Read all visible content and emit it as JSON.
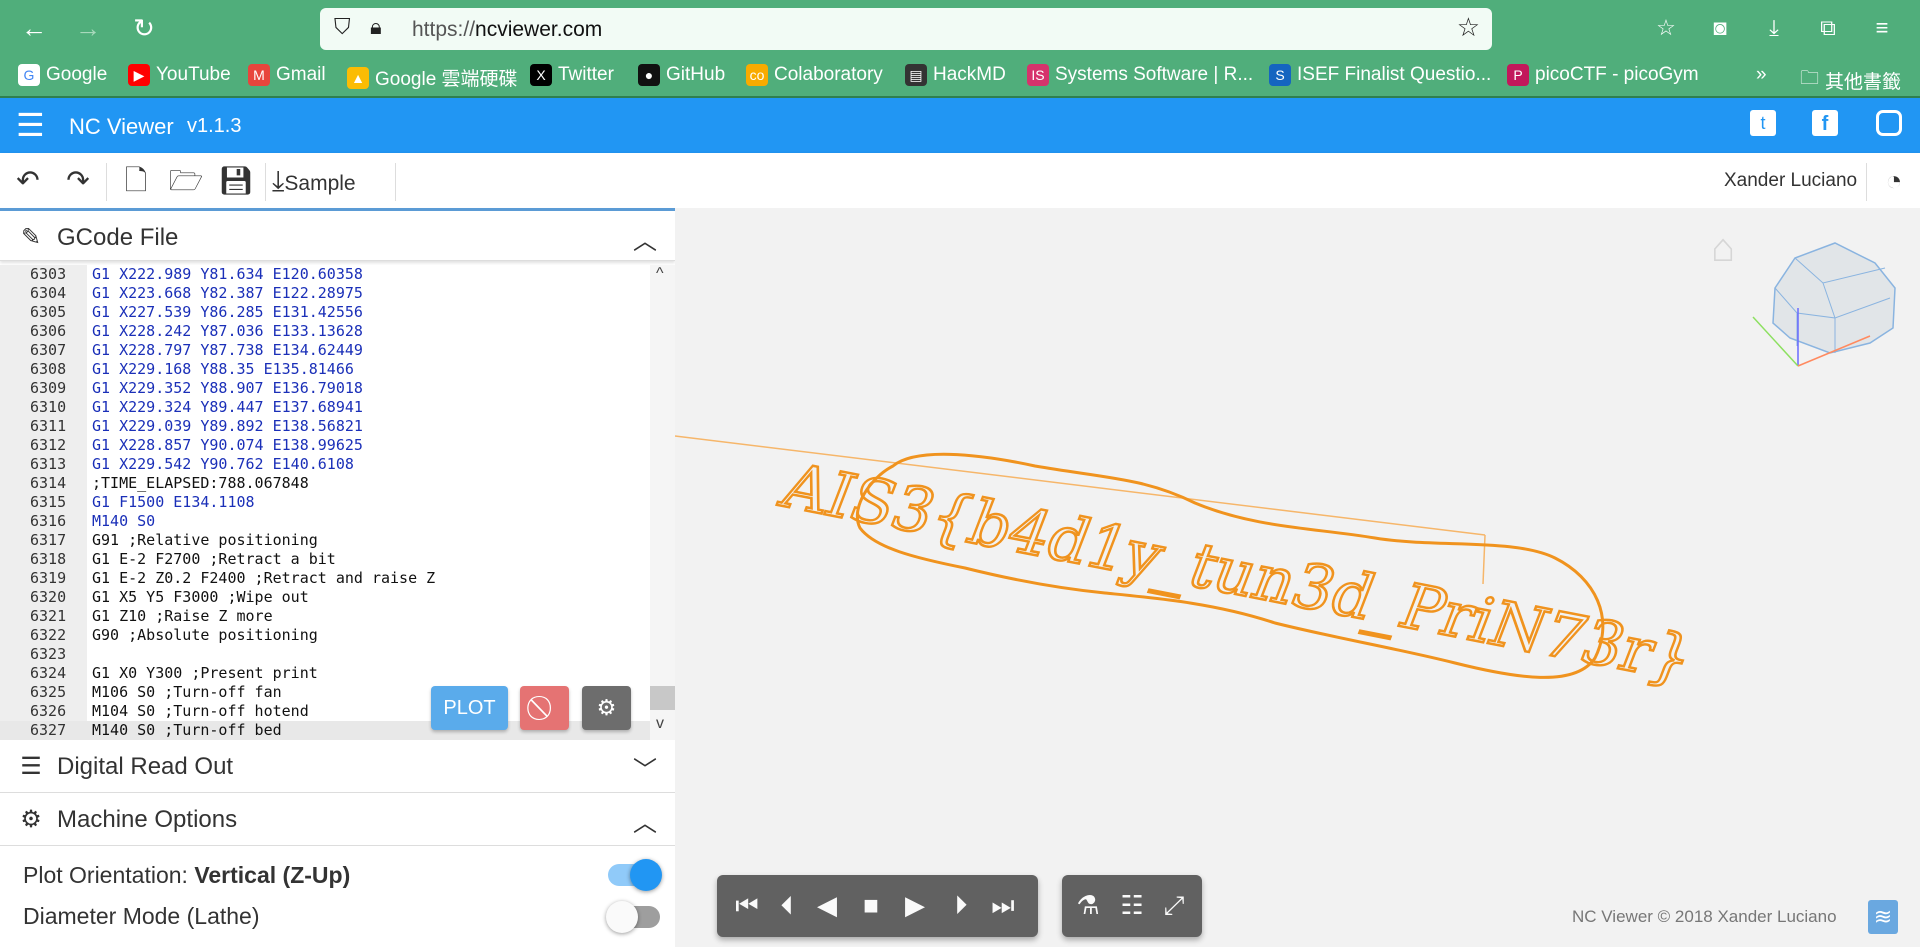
{
  "browser": {
    "url_prefix": "https://",
    "url_host": "ncviewer.com",
    "bookmarks": [
      {
        "label": "Google",
        "color": "#ffffff",
        "glyph": "G"
      },
      {
        "label": "YouTube",
        "color": "#ff0000",
        "glyph": "▶"
      },
      {
        "label": "Gmail",
        "color": "#e8453c",
        "glyph": "M"
      },
      {
        "label": "Google 雲端硬碟",
        "color": "#fbbc04",
        "glyph": "▲"
      },
      {
        "label": "Twitter",
        "color": "#000000",
        "glyph": "X"
      },
      {
        "label": "GitHub",
        "color": "#111111",
        "glyph": "●"
      },
      {
        "label": "Colaboratory",
        "color": "#f9ab00",
        "glyph": "co"
      },
      {
        "label": "HackMD",
        "color": "#333333",
        "glyph": "▤"
      },
      {
        "label": "Systems Software | R...",
        "color": "#d6336c",
        "glyph": "IS"
      },
      {
        "label": "ISEF Finalist Questio...",
        "color": "#1565c0",
        "glyph": "S"
      },
      {
        "label": "picoCTF - picoGym",
        "color": "#c2185b",
        "glyph": "P"
      }
    ],
    "other_bookmarks": "其他書籤"
  },
  "app": {
    "title": "NC Viewer",
    "version": "v1.1.3",
    "user": "Xander Luciano",
    "sample_label": "Sample"
  },
  "gcode_panel": {
    "title": "GCode File",
    "lines": [
      {
        "n": "6303",
        "t": "G1 X222.989 Y81.634 E120.60358"
      },
      {
        "n": "6304",
        "t": "G1 X223.668 Y82.387 E122.28975"
      },
      {
        "n": "6305",
        "t": "G1 X227.539 Y86.285 E131.42556"
      },
      {
        "n": "6306",
        "t": "G1 X228.242 Y87.036 E133.13628"
      },
      {
        "n": "6307",
        "t": "G1 X228.797 Y87.738 E134.62449"
      },
      {
        "n": "6308",
        "t": "G1 X229.168 Y88.35 E135.81466"
      },
      {
        "n": "6309",
        "t": "G1 X229.352 Y88.907 E136.79018"
      },
      {
        "n": "6310",
        "t": "G1 X229.324 Y89.447 E137.68941"
      },
      {
        "n": "6311",
        "t": "G1 X229.039 Y89.892 E138.56821"
      },
      {
        "n": "6312",
        "t": "G1 X228.857 Y90.074 E138.99625"
      },
      {
        "n": "6313",
        "t": "G1 X229.542 Y90.762 E140.6108"
      },
      {
        "n": "6314",
        "t": ";TIME_ELAPSED:788.067848"
      },
      {
        "n": "6315",
        "t": "G1 F1500 E134.1108"
      },
      {
        "n": "6316",
        "t": "M140 S0"
      },
      {
        "n": "6317",
        "t": "G91 ;Relative positioning"
      },
      {
        "n": "6318",
        "t": "G1 E-2 F2700 ;Retract a bit"
      },
      {
        "n": "6319",
        "t": "G1 E-2 Z0.2 F2400 ;Retract and raise Z"
      },
      {
        "n": "6320",
        "t": "G1 X5 Y5 F3000 ;Wipe out"
      },
      {
        "n": "6321",
        "t": "G1 Z10 ;Raise Z more"
      },
      {
        "n": "6322",
        "t": "G90 ;Absolute positioning"
      },
      {
        "n": "6323",
        "t": ""
      },
      {
        "n": "6324",
        "t": "G1 X0 Y300 ;Present print"
      },
      {
        "n": "6325",
        "t": "M106 S0 ;Turn-off fan"
      },
      {
        "n": "6326",
        "t": "M104 S0 ;Turn-off hotend"
      },
      {
        "n": "6327",
        "t": "M140 S0 ;Turn-off bed"
      }
    ],
    "plot_label": "PLOT"
  },
  "dro_panel": {
    "title": "Digital Read Out"
  },
  "machine_panel": {
    "title": "Machine Options",
    "plot_orientation_label": "Plot Orientation: ",
    "plot_orientation_value": "Vertical (Z-Up)",
    "plot_orientation_on": true,
    "diameter_label": "Diameter Mode (Lathe)",
    "diameter_on": false
  },
  "viewer": {
    "plot_text": "AIS3{b4d1y_tun3d_PriN73r}",
    "plot_color": "#f0931e",
    "footer": "NC Viewer © 2018 Xander Luciano"
  },
  "colors": {
    "browser": "#50ae7b",
    "appbar": "#2196f3",
    "plot_button": "#5aabeb",
    "stop_button": "#e57373",
    "settings_button": "#6d6d6d"
  }
}
